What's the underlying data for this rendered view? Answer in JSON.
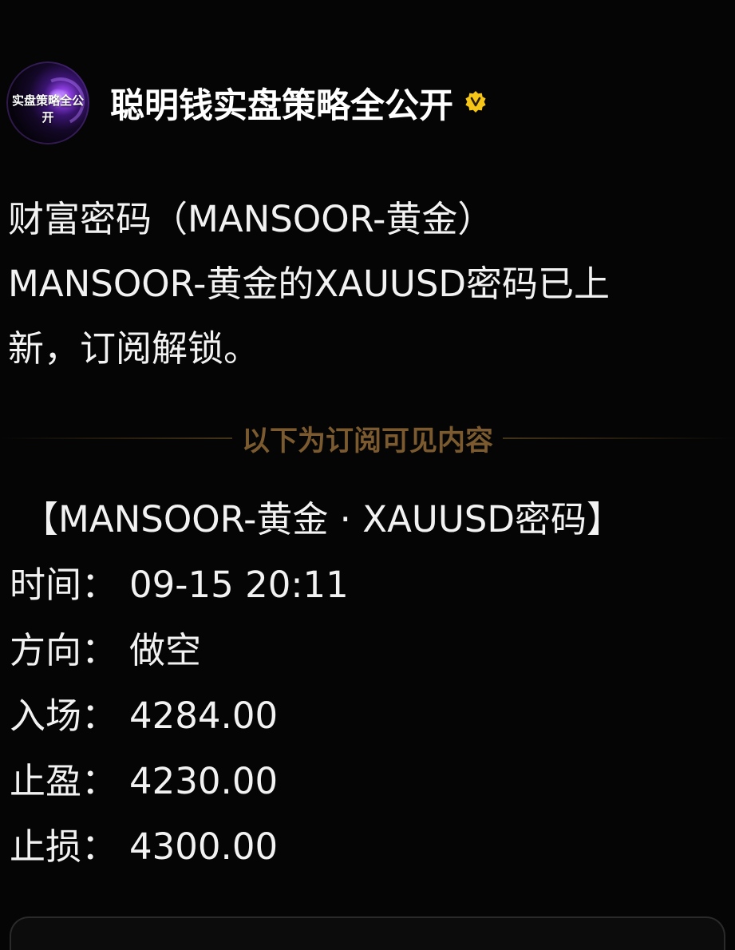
{
  "channel": {
    "avatar_text": "实盘策略全公开",
    "name": "聪明钱实盘策略全公开",
    "verified_color": "#f5c518"
  },
  "intro": {
    "lines": [
      "财富密码（MANSOOR-黄金）",
      "MANSOOR-黄金的XAUUSD密码已上",
      "新，订阅解锁。"
    ]
  },
  "divider": {
    "text": "以下为订阅可见内容"
  },
  "signal": {
    "title": "【MANSOOR-黄金 · XAUUSD密码】",
    "rows": [
      {
        "label": "时间：",
        "value": "09-15 20:11"
      },
      {
        "label": "方向：",
        "value": "做空"
      },
      {
        "label": "入场：",
        "value": "4284.00"
      },
      {
        "label": "止盈：",
        "value": "4230.00"
      },
      {
        "label": "止损：",
        "value": "4300.00"
      }
    ]
  },
  "colors": {
    "background": "#050505",
    "text": "#f2f2f2",
    "divider_text": "#7a5a2e"
  }
}
